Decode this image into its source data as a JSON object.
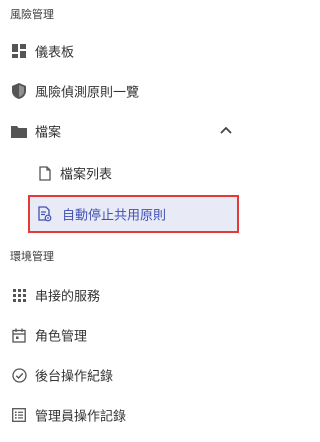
{
  "sections": {
    "risk": "風險管理",
    "env": "環境管理"
  },
  "items": {
    "dashboard": "儀表板",
    "rules": "風險偵測原則一覽",
    "files": "檔案",
    "file_list": "檔案列表",
    "auto_stop": "自動停止共用原則",
    "services": "串接的服務",
    "roles": "角色管理",
    "backend_logs": "後台操作紀錄",
    "admin_logs": "管理員操作記錄"
  },
  "colors": {
    "selected_bg": "#e8eaf6",
    "selected_text": "#3f51b5",
    "highlight_border": "#e53935"
  },
  "icons": {
    "dashboard": "dashboard-icon",
    "rules": "shield-icon",
    "files": "folder-icon",
    "collapse": "chevron-up-icon",
    "file_list": "file-icon",
    "auto_stop": "file-settings-icon",
    "services": "grid-icon",
    "roles": "calendar-icon",
    "backend_logs": "check-circle-icon",
    "admin_logs": "list-icon"
  }
}
